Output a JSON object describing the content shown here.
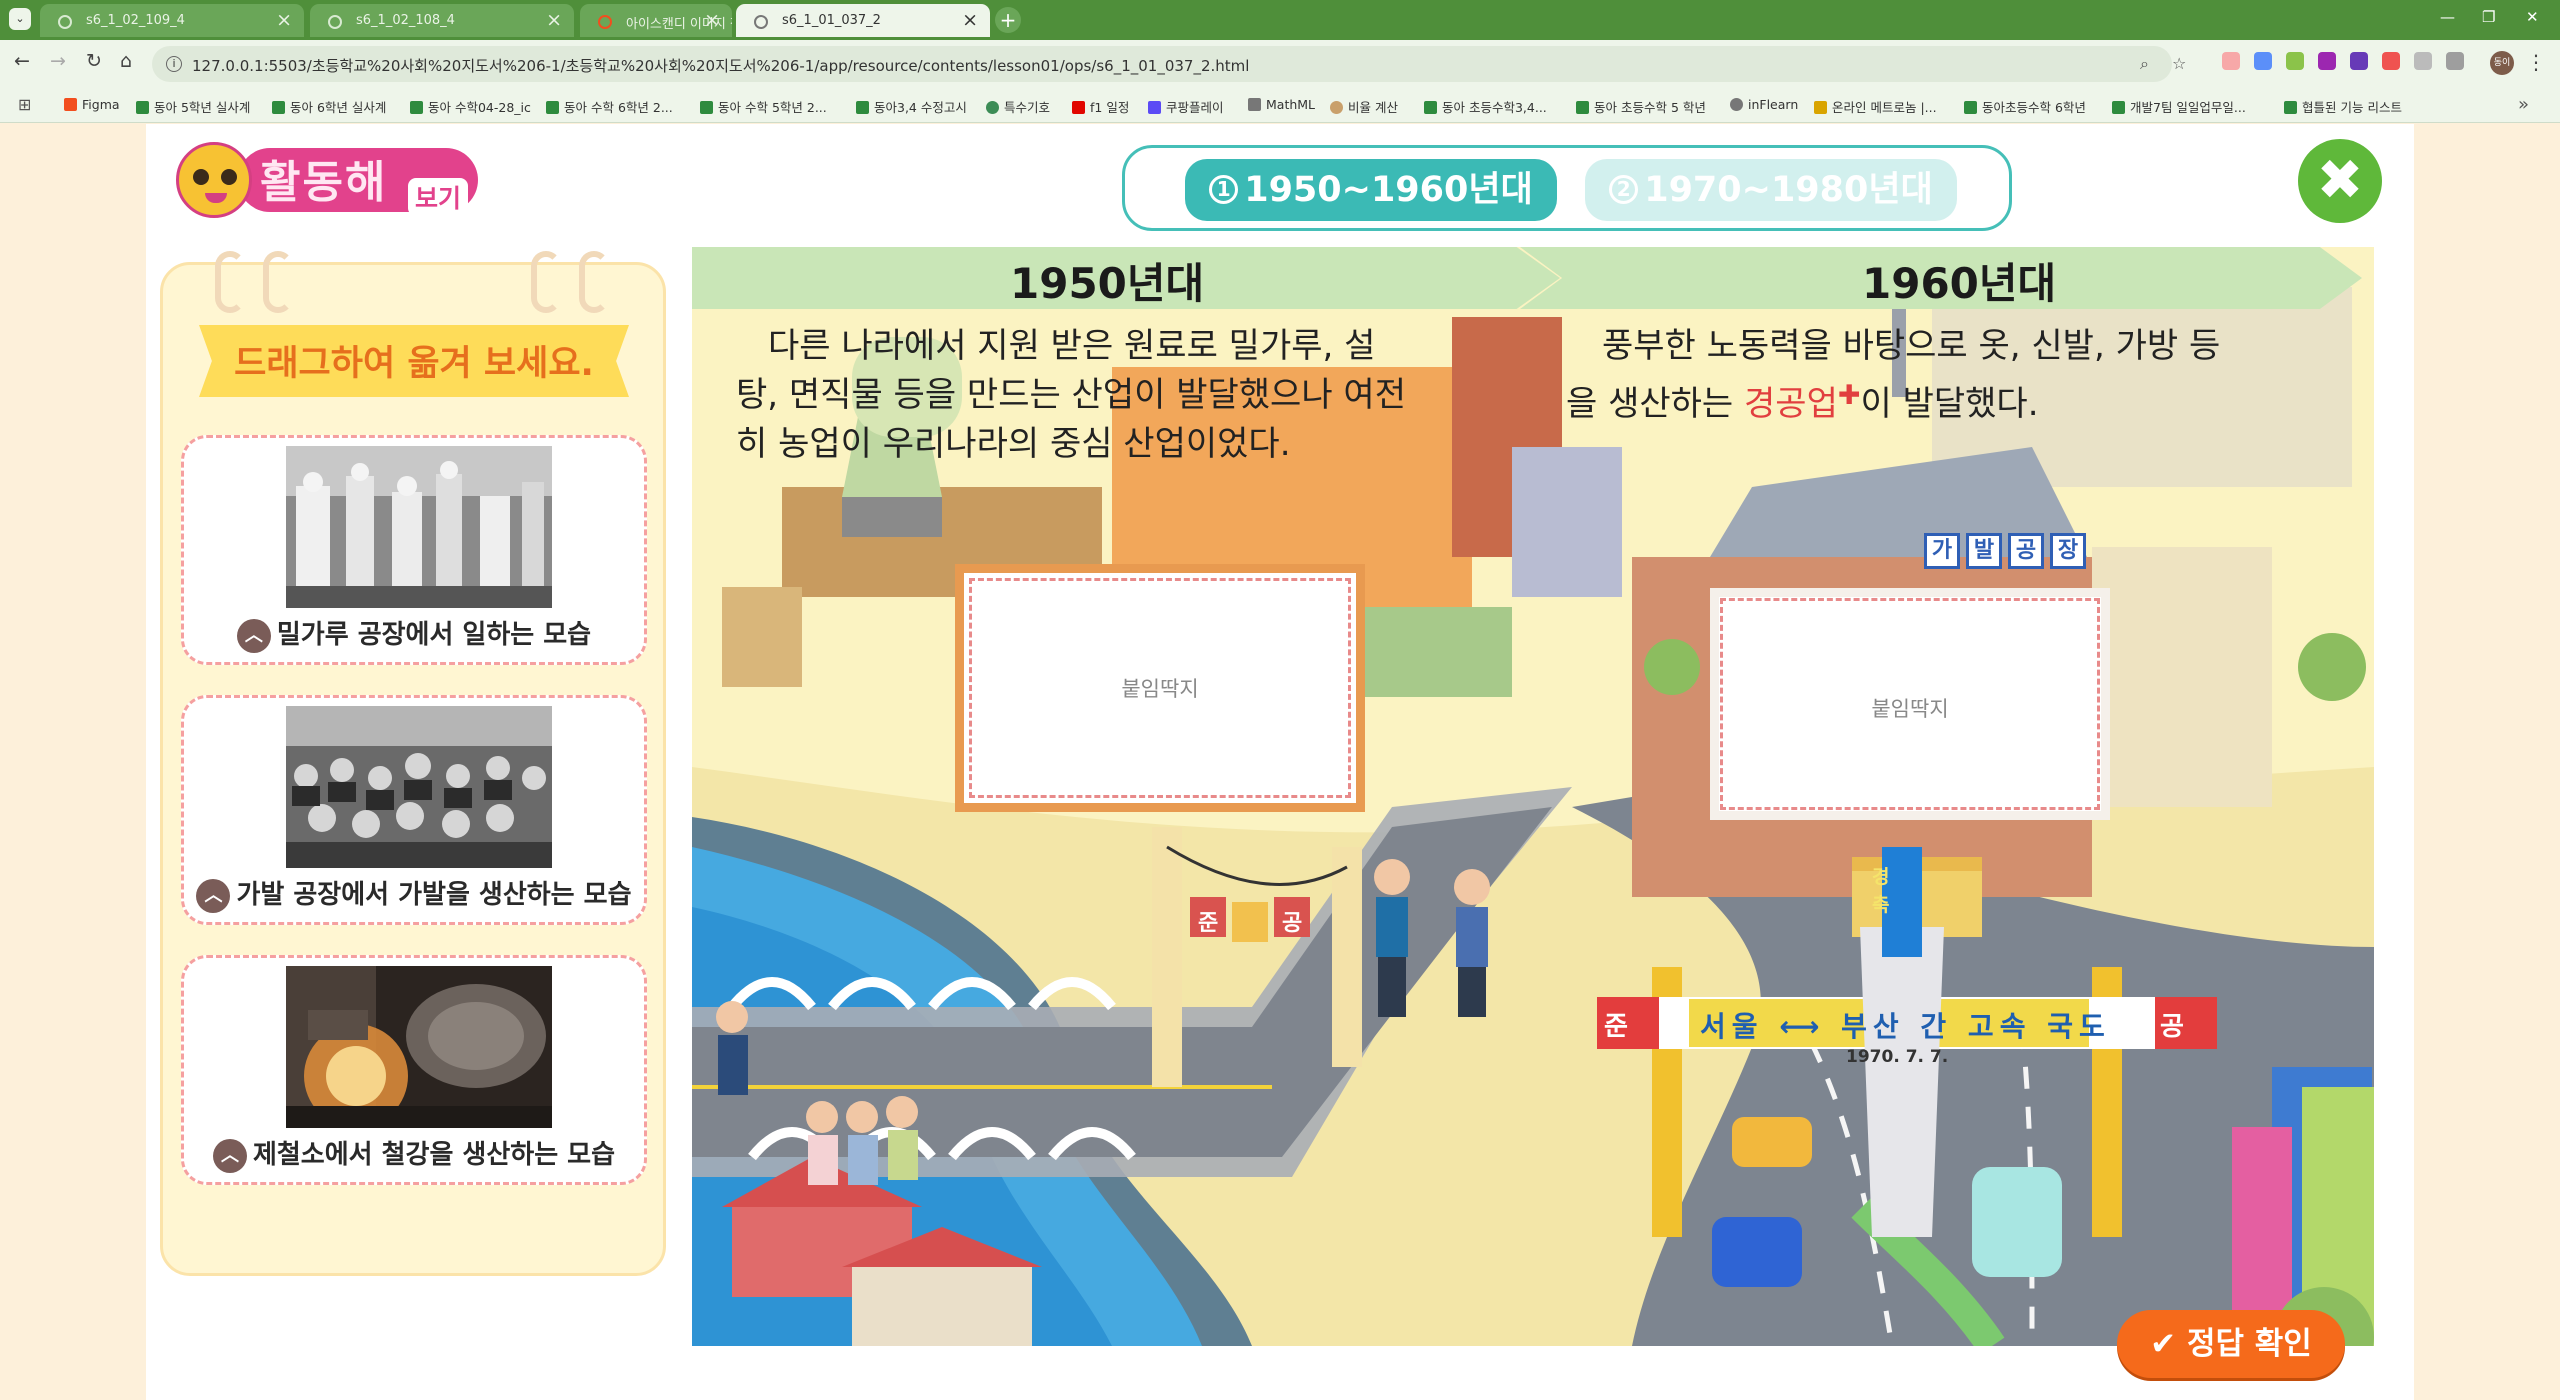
{
  "browser": {
    "tabs": [
      {
        "title": "s6_1_02_109_4"
      },
      {
        "title": "s6_1_02_108_4"
      },
      {
        "title": "아이스캔디 이미지 작업 – Figma"
      },
      {
        "title": "s6_1_01_037_2"
      }
    ],
    "url": "127.0.0.1:5503/초등학교%20사회%20지도서%206-1/초등학교%20사회%20지도서%206-1/app/resource/contents/lesson01/ops/s6_1_01_037_2.html",
    "bookmarks": [
      "Figma",
      "동아 5학년 실사계",
      "동아 6학년 실사계",
      "동아 수학04-28_ic",
      "동아 수학 6학년 2...",
      "동아 수학 5학년 2...",
      "동아3,4 수정고시",
      "특수기호",
      "f1 일정",
      "쿠팡플레이",
      "MathML",
      "비율 계산",
      "동아 초등수학3,4...",
      "동아 초등수학 5 학년",
      "inFlearn",
      "온라인 메트로놈 |...",
      "동아초등수학 6학년",
      "개발7팀 일일업무일...",
      "협틀된 기능 리스트"
    ],
    "profile_initials": "동이"
  },
  "header": {
    "logo_title": "활동해",
    "logo_sub": "보기",
    "era_tabs": [
      {
        "num": "1",
        "label": "1950~1960년대"
      },
      {
        "num": "2",
        "label": "1970~1980년대"
      }
    ],
    "close_symbol": "✖"
  },
  "side_panel": {
    "instruction": "드래그하여 옮겨 보세요.",
    "cards": [
      {
        "caption": "밀가루 공장에서 일하는 모습"
      },
      {
        "caption": "가발 공장에서 가발을 생산하는 모습"
      },
      {
        "caption": "제철소에서 철강을 생산하는 모습"
      }
    ]
  },
  "main": {
    "era1": {
      "title": "1950년대",
      "desc_lines": [
        "다른 나라에서 지원 받은 원료로 밀가루, 설",
        "탕, 면직물 등을 만드는 산업이 발달했으나 여전",
        "히 농업이 우리나라의 중심 산업이었다."
      ],
      "sticker": "붙임딱지"
    },
    "era2": {
      "title": "1960년대",
      "desc_line1": "풍부한 노동력을 바탕으로 옷, 신발, 가방 등",
      "desc_line2_pre": "을 생산하는 ",
      "desc_highlight": "경공업",
      "desc_line2_post": "이 발달했다.",
      "sticker": "붙임딱지"
    },
    "scene": {
      "factory_sign": [
        "가",
        "발",
        "공",
        "장"
      ],
      "bridge_banner": [
        "준",
        "공"
      ],
      "highway_banner": "서울 ⟷ 부산 간 고속 국도",
      "highway_banner_ends": [
        "준",
        "공"
      ],
      "highway_date": "1970. 7. 7.",
      "tower_sign": [
        "경",
        "축"
      ]
    },
    "answer_button": "정답 확인"
  },
  "colors": {
    "tab_active": "#3bbab5",
    "close": "#5fb83a",
    "answer": "#f56a1b",
    "highlight": "#e13f3f"
  }
}
